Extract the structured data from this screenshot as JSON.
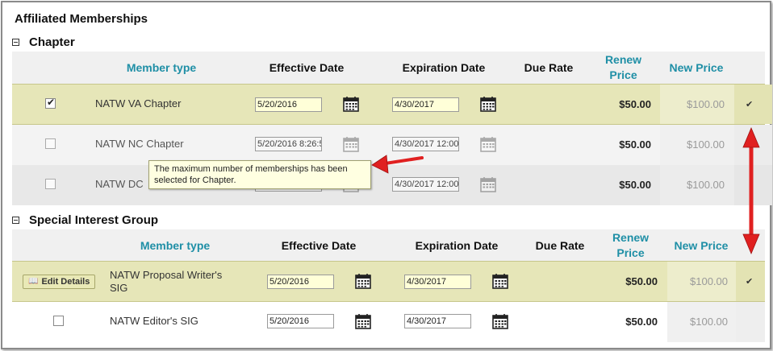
{
  "page_title": "Affiliated Memberships",
  "sections": [
    {
      "title": "Chapter",
      "headers": {
        "member_type": "Member type",
        "effective_date": "Effective Date",
        "expiration_date": "Expiration Date",
        "due_rate": "Due Rate",
        "renew_price_line1": "Renew",
        "renew_price_line2": "Price",
        "new_price": "New Price"
      },
      "rows": [
        {
          "name": "NATW VA Chapter",
          "checked": true,
          "effective": "5/20/2016",
          "expiration": "4/30/2017",
          "renew_price": "$50.00",
          "new_price": "$100.00",
          "selected_tick": "✔"
        },
        {
          "name": "NATW NC Chapter",
          "checked": false,
          "effective": "5/20/2016 8:26:5",
          "expiration": "4/30/2017 12:00:",
          "renew_price": "$50.00",
          "new_price": "$100.00"
        },
        {
          "name": "NATW DC",
          "checked": false,
          "effective": "",
          "expiration": "4/30/2017 12:00:",
          "renew_price": "$50.00",
          "new_price": "$100.00"
        }
      ],
      "tooltip": "The maximum number of memberships has been selected for Chapter."
    },
    {
      "title": "Special Interest Group",
      "headers": {
        "member_type": "Member type",
        "effective_date": "Effective Date",
        "expiration_date": "Expiration Date",
        "due_rate": "Due Rate",
        "renew_price_line1": "Renew",
        "renew_price_line2": "Price",
        "new_price": "New Price"
      },
      "rows": [
        {
          "name_line1": "NATW Proposal Writer's",
          "name_line2": "SIG",
          "button": "Edit Details",
          "effective": "5/20/2016",
          "expiration": "4/30/2017",
          "renew_price": "$50.00",
          "new_price": "$100.00",
          "selected_tick": "✔"
        },
        {
          "name": "NATW Editor's SIG",
          "checked": false,
          "effective": "5/20/2016",
          "expiration": "4/30/2017",
          "renew_price": "$50.00",
          "new_price": "$100.00"
        }
      ]
    }
  ],
  "icons": {
    "calendar": "calendar-icon",
    "collapse": "collapse-minus-icon",
    "book": "book-icon",
    "annotation_arrow": "red-arrow"
  },
  "colors": {
    "header_link": "#1f8fa6",
    "selected_row": "#e6e6b8",
    "annotation": "#e02020"
  }
}
